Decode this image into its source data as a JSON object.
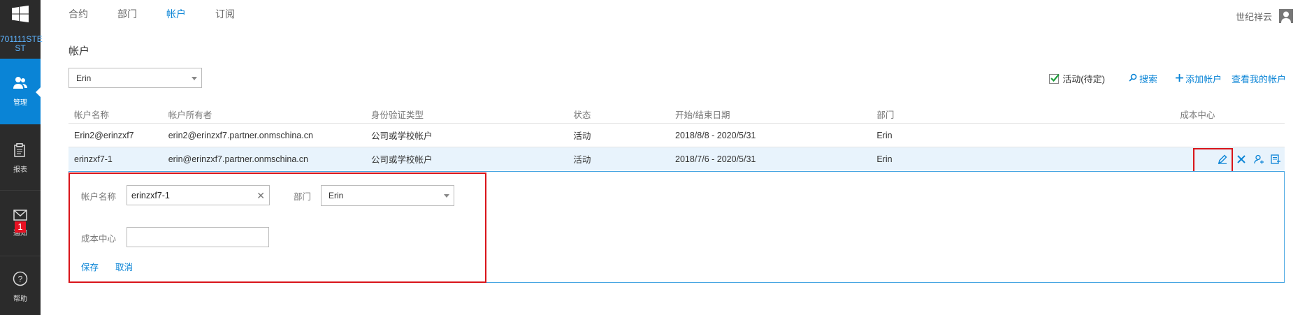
{
  "rail": {
    "tenant_line1": "701111STE",
    "tenant_line2": "ST",
    "manage_label": "管理",
    "reports_label": "报表",
    "notify_label": "通知",
    "notify_count": "1",
    "help_label": "帮助"
  },
  "tabs": [
    {
      "label": "合约"
    },
    {
      "label": "部门"
    },
    {
      "label": "帐户"
    },
    {
      "label": "订阅"
    }
  ],
  "user": {
    "name": "世纪祥云"
  },
  "page_title": "帐户",
  "filter": {
    "selected": "Erin"
  },
  "actions": {
    "active_label": "活动(待定)",
    "search_label": "搜索",
    "add_label": "添加帐户",
    "view_mine_label": "查看我的帐户"
  },
  "table": {
    "headers": [
      "帐户名称",
      "帐户所有者",
      "身份验证类型",
      "状态",
      "开始/结束日期",
      "部门",
      "成本中心"
    ],
    "rows": [
      [
        "Erin2@erinzxf7",
        "erin2@erinzxf7.partner.onmschina.cn",
        "公司或学校帐户",
        "活动",
        "2018/8/8 - 2020/5/31",
        "Erin",
        ""
      ],
      [
        "erinzxf7-1",
        "erin@erinzxf7.partner.onmschina.cn",
        "公司或学校帐户",
        "活动",
        "2018/7/6 - 2020/5/31",
        "Erin",
        ""
      ]
    ]
  },
  "edit": {
    "account_name_label": "帐户名称",
    "account_name_value": "erinzxf7-1",
    "dept_label": "部门",
    "dept_value": "Erin",
    "cost_center_label": "成本中心",
    "cost_center_value": "",
    "save_label": "保存",
    "cancel_label": "取消"
  },
  "colors": {
    "accent": "#0a84d6",
    "rail": "#2b2b2b",
    "highlight": "#d9141a"
  }
}
